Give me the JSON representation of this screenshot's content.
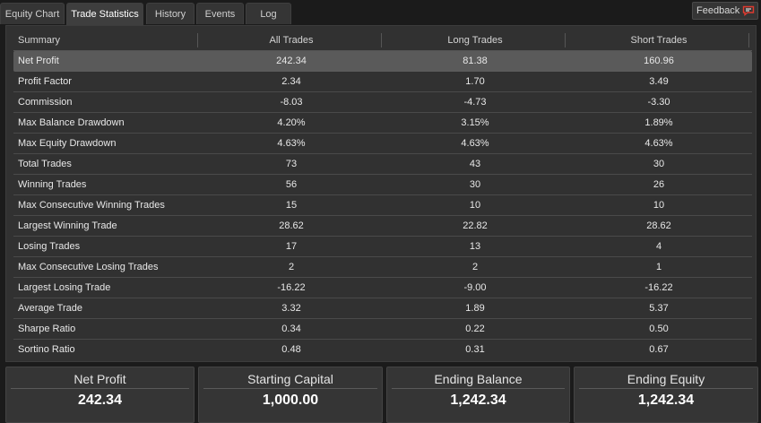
{
  "tabs": [
    {
      "label": "Equity Chart"
    },
    {
      "label": "Trade Statistics"
    },
    {
      "label": "History"
    },
    {
      "label": "Events"
    },
    {
      "label": "Log"
    }
  ],
  "active_tab": "Trade Statistics",
  "feedback": {
    "label": "Feedback"
  },
  "table": {
    "columns": [
      "Summary",
      "All Trades",
      "Long Trades",
      "Short Trades"
    ],
    "selected_row": "Net Profit",
    "rows": [
      {
        "label": "Net Profit",
        "all": "242.34",
        "long": "81.38",
        "short": "160.96"
      },
      {
        "label": "Profit Factor",
        "all": "2.34",
        "long": "1.70",
        "short": "3.49"
      },
      {
        "label": "Commission",
        "all": "-8.03",
        "long": "-4.73",
        "short": "-3.30"
      },
      {
        "label": "Max Balance Drawdown",
        "all": "4.20%",
        "long": "3.15%",
        "short": "1.89%"
      },
      {
        "label": "Max Equity Drawdown",
        "all": "4.63%",
        "long": "4.63%",
        "short": "4.63%"
      },
      {
        "label": "Total Trades",
        "all": "73",
        "long": "43",
        "short": "30"
      },
      {
        "label": "Winning Trades",
        "all": "56",
        "long": "30",
        "short": "26"
      },
      {
        "label": "Max Consecutive Winning Trades",
        "all": "15",
        "long": "10",
        "short": "10"
      },
      {
        "label": "Largest Winning Trade",
        "all": "28.62",
        "long": "22.82",
        "short": "28.62"
      },
      {
        "label": "Losing Trades",
        "all": "17",
        "long": "13",
        "short": "4"
      },
      {
        "label": "Max Consecutive Losing Trades",
        "all": "2",
        "long": "2",
        "short": "1"
      },
      {
        "label": "Largest Losing Trade",
        "all": "-16.22",
        "long": "-9.00",
        "short": "-16.22"
      },
      {
        "label": "Average Trade",
        "all": "3.32",
        "long": "1.89",
        "short": "5.37"
      },
      {
        "label": "Sharpe Ratio",
        "all": "0.34",
        "long": "0.22",
        "short": "0.50"
      },
      {
        "label": "Sortino Ratio",
        "all": "0.48",
        "long": "0.31",
        "short": "0.67"
      }
    ]
  },
  "cards": [
    {
      "title": "Net Profit",
      "value": "242.34"
    },
    {
      "title": "Starting Capital",
      "value": "1,000.00"
    },
    {
      "title": "Ending Balance",
      "value": "1,242.34"
    },
    {
      "title": "Ending Equity",
      "value": "1,242.34"
    }
  ],
  "colors": {
    "background": "#1b1b1b",
    "panel": "#313131",
    "selected_row": "#5a5a5a",
    "feedback_icon": "#e03a2f"
  },
  "icons": {
    "feedback": "speech-bubble-icon"
  }
}
